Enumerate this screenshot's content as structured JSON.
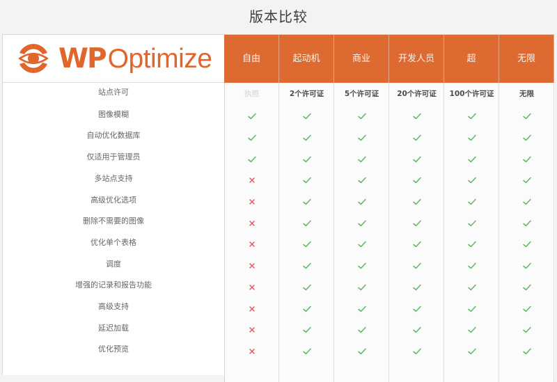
{
  "title": "版本比较",
  "brand": {
    "name_bold": "WP",
    "name_regular": "Optimize",
    "color": "#e0662c",
    "header_color": "#dd6a31"
  },
  "icons": {
    "available": "check-icon",
    "unavailable": "cross-icon",
    "check_color": "#5cb85c",
    "cross_color": "#e8505b"
  },
  "plans": [
    {
      "label": "自由",
      "license": "执照"
    },
    {
      "label": "起动机",
      "license": "2个许可证"
    },
    {
      "label": "商业",
      "license": "5个许可证"
    },
    {
      "label": "开发人员",
      "license": "20个许可证"
    },
    {
      "label": "超",
      "license": "100个许可证"
    },
    {
      "label": "无限",
      "license": "无限"
    }
  ],
  "license_row_label": "站点许可",
  "features": [
    {
      "label": "图像模糊",
      "availability": [
        true,
        true,
        true,
        true,
        true,
        true
      ]
    },
    {
      "label": "自动优化数据库",
      "availability": [
        true,
        true,
        true,
        true,
        true,
        true
      ]
    },
    {
      "label": "仅适用于管理员",
      "availability": [
        true,
        true,
        true,
        true,
        true,
        true
      ]
    },
    {
      "label": "多站点支持",
      "availability": [
        false,
        true,
        true,
        true,
        true,
        true
      ]
    },
    {
      "label": "高级优化选项",
      "availability": [
        false,
        true,
        true,
        true,
        true,
        true
      ]
    },
    {
      "label": "删除不需要的图像",
      "availability": [
        false,
        true,
        true,
        true,
        true,
        true
      ]
    },
    {
      "label": "优化单个表格",
      "availability": [
        false,
        true,
        true,
        true,
        true,
        true
      ]
    },
    {
      "label": "调度",
      "availability": [
        false,
        true,
        true,
        true,
        true,
        true
      ]
    },
    {
      "label": "增强的记录和报告功能",
      "availability": [
        false,
        true,
        true,
        true,
        true,
        true
      ]
    },
    {
      "label": "高级支持",
      "availability": [
        false,
        true,
        true,
        true,
        true,
        true
      ]
    },
    {
      "label": "延迟加载",
      "availability": [
        false,
        true,
        true,
        true,
        true,
        true
      ]
    },
    {
      "label": "优化预览",
      "availability": [
        false,
        true,
        true,
        true,
        true,
        true
      ]
    }
  ]
}
